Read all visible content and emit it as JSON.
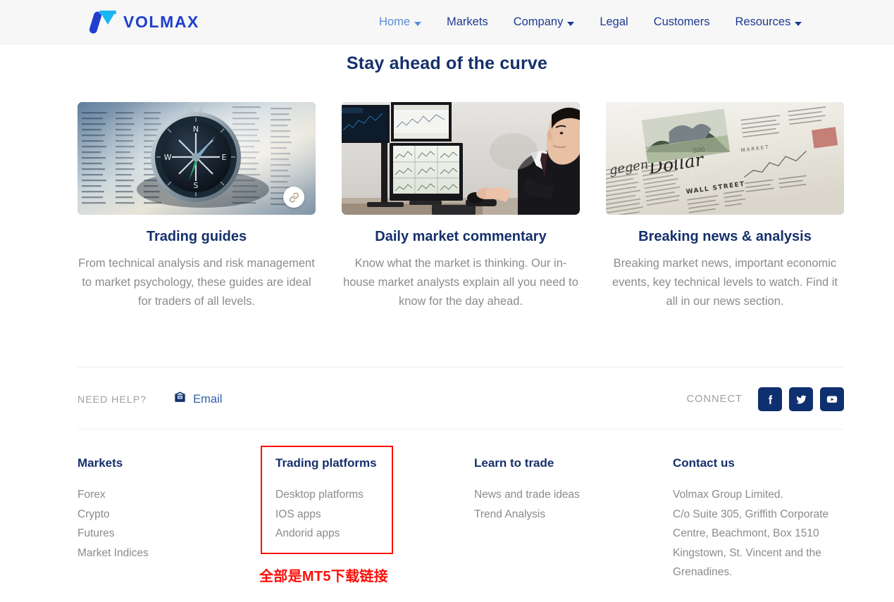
{
  "header": {
    "logo": {
      "text": "VOLMAX",
      "mark": "volmax-logo-mark",
      "colors": {
        "slash": "#1e3fd0",
        "triangle": "#18b6f5"
      }
    },
    "nav": [
      {
        "label": "Home",
        "has_caret": true,
        "active": true
      },
      {
        "label": "Markets",
        "has_caret": false,
        "active": false
      },
      {
        "label": "Company",
        "has_caret": true,
        "active": false
      },
      {
        "label": "Legal",
        "has_caret": false,
        "active": false
      },
      {
        "label": "Customers",
        "has_caret": false,
        "active": false
      },
      {
        "label": "Resources",
        "has_caret": true,
        "active": false
      }
    ]
  },
  "main": {
    "title": "Stay ahead of the curve",
    "cards": [
      {
        "image_alt": "compass-on-financial-newspaper",
        "badge_icon": "link-icon",
        "title": "Trading guides",
        "text": "From technical analysis and risk management to market psychology, these guides are ideal for traders of all levels."
      },
      {
        "image_alt": "trader-at-multi-monitor-desk",
        "badge_icon": null,
        "title": "Daily market commentary",
        "text": "Know what the market is thinking. Our in-house market analysts explain all you need to know for the day ahead."
      },
      {
        "image_alt": "financial-newspaper-wall-street",
        "badge_icon": null,
        "title": "Breaking news & analysis",
        "text": "Breaking market news, important economic events, key technical levels to watch. Find it all in our news section."
      }
    ]
  },
  "help_row": {
    "need_help_label": "NEED HELP?",
    "email_icon": "email-inbox-icon",
    "email_label": "Email",
    "connect_label": "CONNECT",
    "socials": [
      {
        "name": "facebook-icon",
        "label": "f"
      },
      {
        "name": "twitter-icon",
        "label": "t"
      },
      {
        "name": "youtube-icon",
        "label": "y"
      }
    ],
    "social_bg": "#0f3070"
  },
  "footer": {
    "columns": [
      {
        "heading": "Markets",
        "items": [
          "Forex",
          "Crypto",
          "Futures",
          "Market Indices"
        ]
      },
      {
        "heading": "Trading platforms",
        "items": [
          "Desktop platforms",
          "IOS apps",
          "Andorid apps"
        ]
      },
      {
        "heading": "Learn to trade",
        "items": [
          "News and trade ideas",
          "Trend Analysis"
        ]
      },
      {
        "heading": "Contact us",
        "items": [
          "Volmax Group Limited.",
          "C/o Suite 305, Griffith Corporate",
          "Centre, Beachmont, Box 1510",
          "Kingstown, St. Vincent and the",
          "Grenadines."
        ]
      }
    ]
  },
  "annotation": {
    "box_color": "#fb0f09",
    "text": "全部是MT5下载链接"
  }
}
